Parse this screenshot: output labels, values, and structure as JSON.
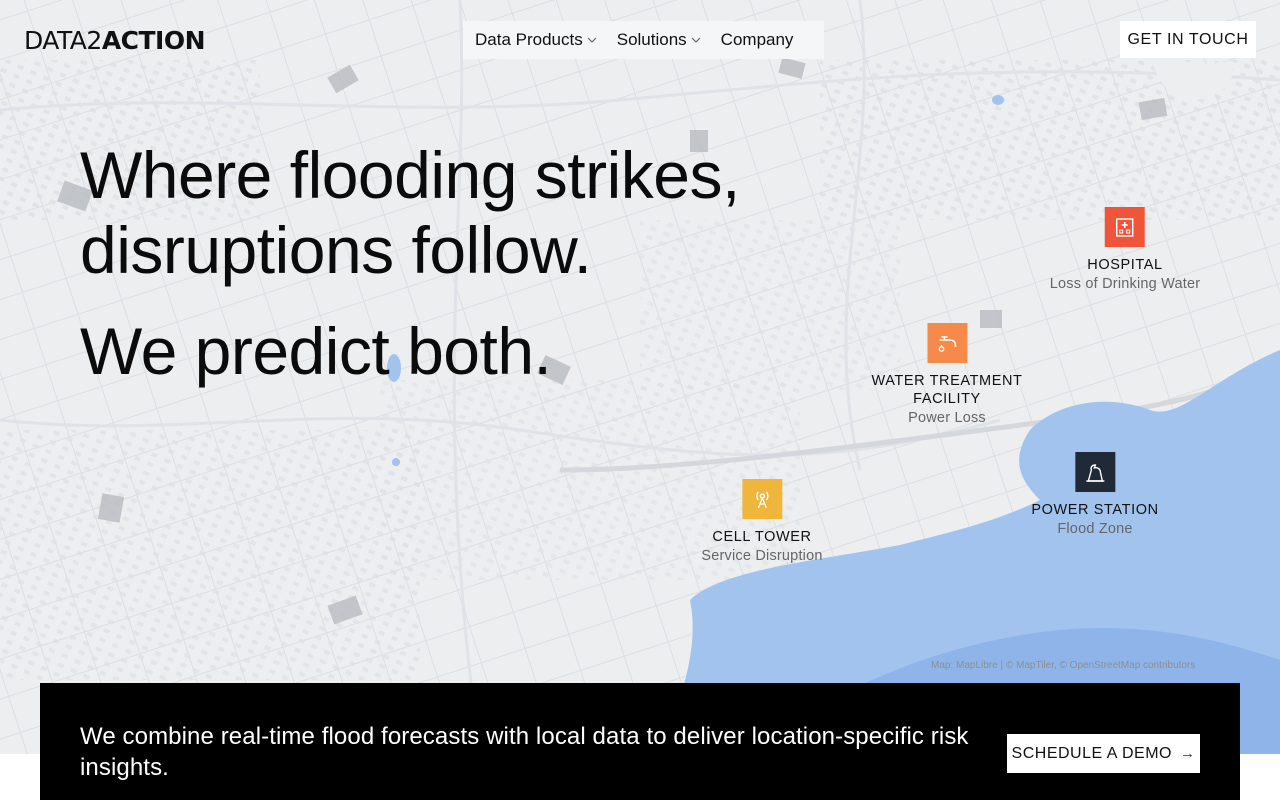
{
  "brand": {
    "logo_text_light": "DATA2",
    "logo_text_bold": "ACTION"
  },
  "nav": {
    "items": [
      {
        "label": "Data Products",
        "has_dropdown": true
      },
      {
        "label": "Solutions",
        "has_dropdown": true
      },
      {
        "label": "Company",
        "has_dropdown": false
      }
    ],
    "cta_label": "GET IN TOUCH"
  },
  "hero": {
    "line1": "Where flooding strikes,",
    "line2": "disruptions follow.",
    "line3": "We predict both."
  },
  "markers": [
    {
      "title": "HOSPITAL",
      "subtitle": "Loss of Drinking Water",
      "icon": "hospital-icon",
      "color": "#f0553a"
    },
    {
      "title": "WATER TREATMENT FACILITY",
      "title_line1": "WATER TREATMENT",
      "title_line2": "FACILITY",
      "subtitle": "Power Loss",
      "icon": "water-tap-icon",
      "color": "#f58a4b"
    },
    {
      "title": "POWER STATION",
      "subtitle": "Flood Zone",
      "icon": "power-plant-icon",
      "color": "#1f2a36"
    },
    {
      "title": "CELL TOWER",
      "subtitle": "Service Disruption",
      "icon": "cell-tower-icon",
      "color": "#f0b63c"
    }
  ],
  "map": {
    "attribution": "Map: MapLibre | © MapTiler, © OpenStreetMap contributors",
    "water_color": "#a3c3ef",
    "land_color": "#eceef0"
  },
  "banner": {
    "text": "We combine real-time flood forecasts with local data to deliver location-specific risk insights.",
    "button_label": "SCHEDULE A DEMO"
  }
}
